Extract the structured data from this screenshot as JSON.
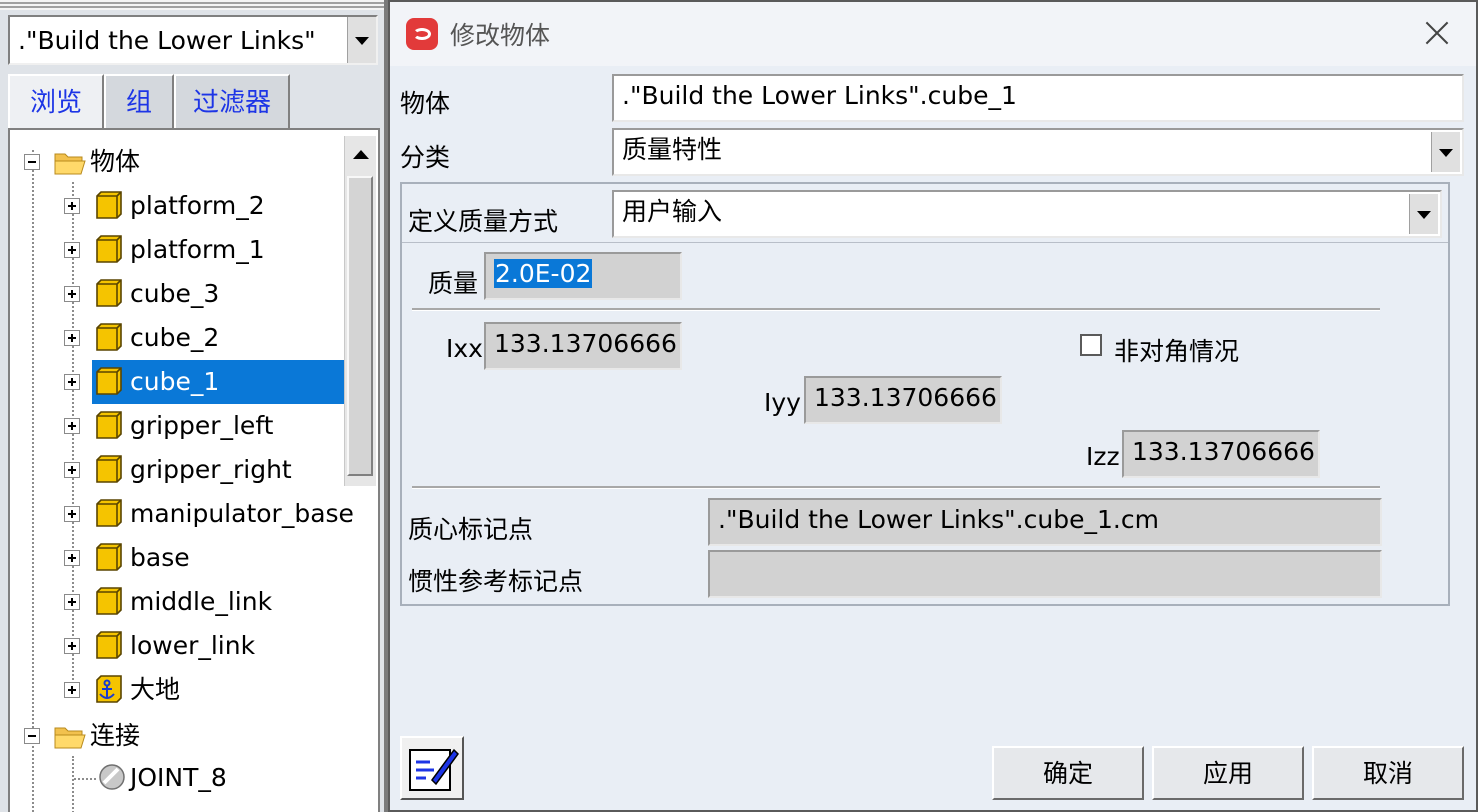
{
  "left_panel": {
    "model_selector": {
      "value": ".\"Build the Lower Links\""
    },
    "tabs": [
      {
        "label": "浏览"
      },
      {
        "label": "组"
      },
      {
        "label": "过滤器"
      }
    ],
    "tree": {
      "bodies_folder": "物体",
      "bodies": [
        {
          "label": "platform_2"
        },
        {
          "label": "platform_1"
        },
        {
          "label": "cube_3"
        },
        {
          "label": "cube_2"
        },
        {
          "label": "cube_1",
          "selected": true
        },
        {
          "label": "gripper_left"
        },
        {
          "label": "gripper_right"
        },
        {
          "label": "manipulator_base"
        },
        {
          "label": "base"
        },
        {
          "label": "middle_link"
        },
        {
          "label": "lower_link"
        },
        {
          "label": "大地",
          "icon": "anchor-icon"
        }
      ],
      "connections_folder": "连接",
      "connections": [
        {
          "label": "JOINT_8"
        }
      ]
    }
  },
  "dialog": {
    "title": "修改物体",
    "body_label": "物体",
    "body_value": ".\"Build the Lower Links\".cube_1",
    "category_label": "分类",
    "category_value": "质量特性",
    "define_mass_label": "定义质量方式",
    "define_mass_value": "用户输入",
    "mass_label": "质量",
    "mass_value": "2.0E-02",
    "ixx_label": "Ixx",
    "ixx_value": "133.13706666",
    "iyy_label": "Iyy",
    "iyy_value": "133.13706666",
    "izz_label": "Izz",
    "izz_value": "133.13706666",
    "off_diagonal_label": "非对角情况",
    "off_diagonal_checked": false,
    "cm_marker_label": "质心标记点",
    "cm_marker_value": ".\"Build the Lower Links\".cube_1.cm",
    "inertia_marker_label": "惯性参考标记点",
    "inertia_marker_value": "",
    "buttons": {
      "ok": "确定",
      "apply": "应用",
      "cancel": "取消"
    }
  },
  "colors": {
    "selection": "#0a78d7",
    "tab_text": "#1d35e6",
    "cube_icon": "#f5c400",
    "app_icon": "#e23a3a"
  }
}
